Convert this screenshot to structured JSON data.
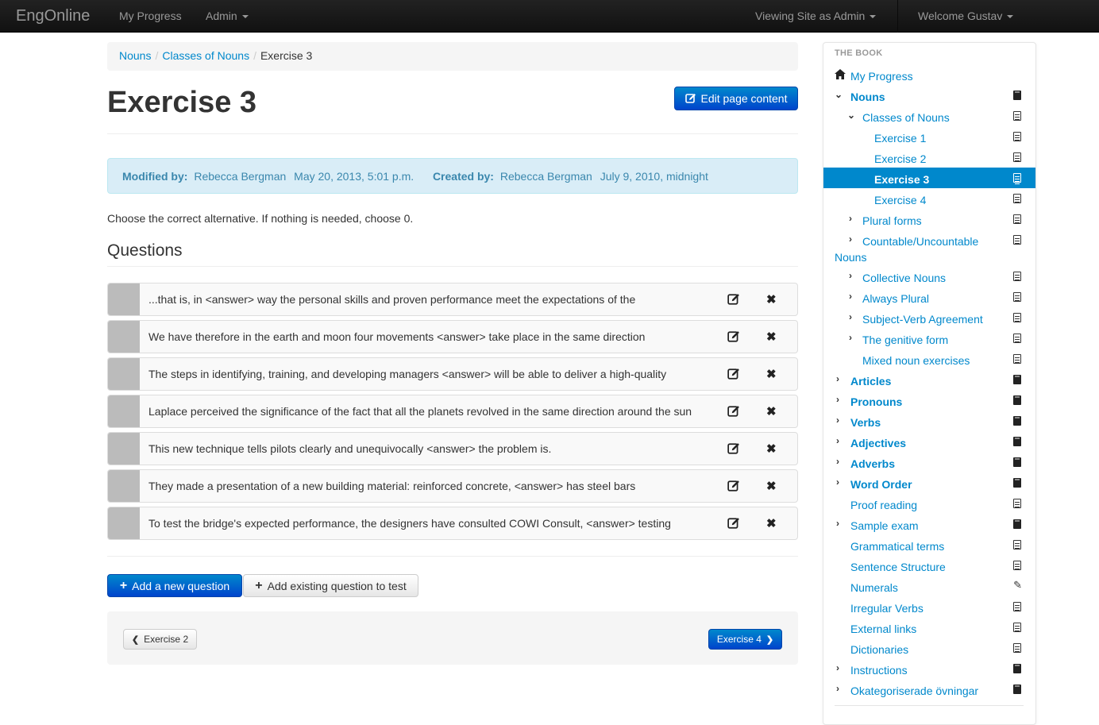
{
  "navbar": {
    "brand": "EngOnline",
    "my_progress": "My Progress",
    "admin": "Admin",
    "viewing_as": "Viewing Site as Admin",
    "welcome": "Welcome Gustav"
  },
  "breadcrumb": {
    "items": [
      "Nouns",
      "Classes of Nouns"
    ],
    "current": "Exercise 3"
  },
  "page": {
    "title": "Exercise 3",
    "edit_label": "Edit page content",
    "modified_label": "Modified by:",
    "modified_by": "Rebecca Bergman",
    "modified_date": "May 20, 2013, 5:01 p.m.",
    "created_label": "Created by:",
    "created_by": "Rebecca Bergman",
    "created_date": "July 9, 2010, midnight",
    "instructions": "Choose the correct alternative. If nothing is needed, choose 0.",
    "questions_title": "Questions"
  },
  "questions": [
    "...that is, in <answer> way the personal skills and proven performance meet the expectations of the",
    "We have therefore in the earth and moon four movements <answer> take place in the same direction",
    "The steps in identifying, training, and developing managers <answer> will be able to deliver a high-quality",
    "Laplace perceived the significance of the fact that all the planets revolved in the same direction around the sun",
    "This new technique tells pilots clearly and unequivocally <answer> the problem is.",
    "They made a presentation of a new building material: reinforced concrete, <answer> has steel bars",
    "To test the bridge's expected performance, the designers have consulted COWI Consult, <answer> testing"
  ],
  "actions": {
    "add_new": "Add a new question",
    "add_existing": "Add existing question to test"
  },
  "pager": {
    "prev": "Exercise 2",
    "next": "Exercise 4"
  },
  "sidebar": {
    "header": "THE BOOK",
    "items": [
      {
        "label": "My Progress"
      },
      {
        "label": "Nouns"
      },
      {
        "label": "Classes of Nouns"
      },
      {
        "label": "Exercise 1"
      },
      {
        "label": "Exercise 2"
      },
      {
        "label": "Exercise 3"
      },
      {
        "label": "Exercise 4"
      },
      {
        "label": "Plural forms"
      },
      {
        "label": "Countable/Uncountable"
      },
      {
        "label": "Nouns"
      },
      {
        "label": "Collective Nouns"
      },
      {
        "label": "Always Plural"
      },
      {
        "label": "Subject-Verb Agreement"
      },
      {
        "label": "The genitive form"
      },
      {
        "label": "Mixed noun exercises"
      },
      {
        "label": "Articles"
      },
      {
        "label": "Pronouns"
      },
      {
        "label": "Verbs"
      },
      {
        "label": "Adjectives"
      },
      {
        "label": "Adverbs"
      },
      {
        "label": "Word Order"
      },
      {
        "label": "Proof reading"
      },
      {
        "label": "Sample exam"
      },
      {
        "label": "Grammatical terms"
      },
      {
        "label": "Sentence Structure"
      },
      {
        "label": "Numerals"
      },
      {
        "label": "Irregular Verbs"
      },
      {
        "label": "External links"
      },
      {
        "label": "Dictionaries"
      },
      {
        "label": "Instructions"
      },
      {
        "label": "Okategoriserade övningar"
      }
    ]
  },
  "colors": {
    "accent": "#0088cc",
    "info_bg": "#d9edf7",
    "info_text": "#3a87ad",
    "navbar": "#1b1b1b"
  }
}
